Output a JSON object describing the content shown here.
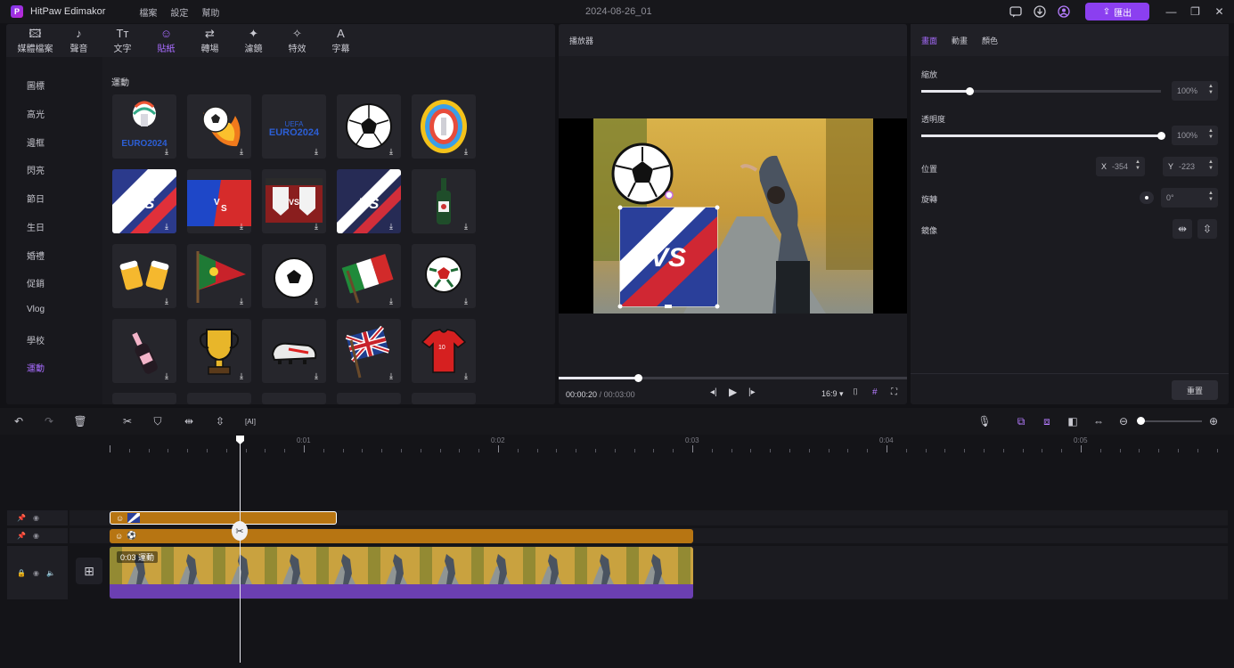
{
  "app": {
    "title": "HitPaw Edimakor",
    "menu": [
      "檔案",
      "設定",
      "幫助"
    ],
    "document_title": "2024-08-26_01",
    "export_label": "匯出",
    "accent_color": "#8b3ff0"
  },
  "media_tabs": [
    {
      "label": "媒體檔案",
      "icon": "media-icon"
    },
    {
      "label": "聲音",
      "icon": "music-icon"
    },
    {
      "label": "文字",
      "icon": "text-icon"
    },
    {
      "label": "貼紙",
      "icon": "sticker-icon",
      "active": true
    },
    {
      "label": "轉場",
      "icon": "transition-icon"
    },
    {
      "label": "濾鏡",
      "icon": "filter-icon"
    },
    {
      "label": "特效",
      "icon": "effects-icon"
    },
    {
      "label": "字幕",
      "icon": "subtitle-icon"
    }
  ],
  "categories": [
    "圖標",
    "高光",
    "邊框",
    "閃亮",
    "節日",
    "生日",
    "婚禮",
    "促銷",
    "Vlog",
    "學校",
    "運動"
  ],
  "active_category": "運動",
  "grid_title": "運動",
  "stickers": [
    "euro-2024-trophy-sticker",
    "flaming-soccer-ball-sticker",
    "euro2024-logo-sticker",
    "soccer-ball-sticker",
    "colorful-trophy-sticker",
    "vs-stripe-sticker",
    "red-blue-vs-sticker",
    "vs-shields-sticker",
    "vs-stripe-dark-sticker",
    "wine-bottle-sticker",
    "beer-cheers-sticker",
    "portugal-pennant-sticker",
    "soccer-ball-white-sticker",
    "italy-flag-sticker",
    "soccer-ball-red-sticker",
    "champagne-bottle-sticker",
    "gold-trophy-sticker",
    "soccer-cleat-sticker",
    "uk-flag-sticker",
    "red-jersey-sticker"
  ],
  "player": {
    "title": "播放器",
    "current_time": "00:00:20",
    "total_time": "00:03:00",
    "aspect": "16:9",
    "progress": 0.23
  },
  "properties": {
    "tabs": [
      "畫面",
      "動畫",
      "顏色"
    ],
    "active_tab": "畫面",
    "scale_label": "縮放",
    "scale_value": "100%",
    "scale_fraction": 0.2,
    "opacity_label": "透明度",
    "opacity_value": "100%",
    "opacity_fraction": 1.0,
    "position_label": "位置",
    "pos_x_label": "X",
    "pos_x_value": "-354",
    "pos_y_label": "Y",
    "pos_y_value": "-223",
    "rotate_label": "旋轉",
    "rotate_value": "0°",
    "mirror_label": "鏡像",
    "reset_label": "重置"
  },
  "timeline": {
    "ruler_labels": [
      "0:01",
      "0:02",
      "0:03",
      "0:04",
      "0:05"
    ],
    "video_clip_label": "0:03 運動"
  }
}
